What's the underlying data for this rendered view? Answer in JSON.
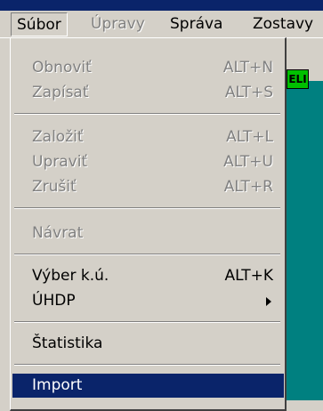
{
  "menubar": {
    "items": [
      {
        "label": "Súbor",
        "state": "active"
      },
      {
        "label": "Úpravy",
        "state": "disabled"
      },
      {
        "label": "Správa",
        "state": "normal"
      },
      {
        "label": "Zostavy",
        "state": "normal"
      }
    ]
  },
  "dropdown": {
    "items": [
      {
        "label": "Obnoviť",
        "shortcut": "ALT+N",
        "enabled": false
      },
      {
        "label": "Zapísať",
        "shortcut": "ALT+S",
        "enabled": false
      },
      {
        "label": "Založiť",
        "shortcut": "ALT+L",
        "enabled": false
      },
      {
        "label": "Upraviť",
        "shortcut": "ALT+U",
        "enabled": false
      },
      {
        "label": "Zrušiť",
        "shortcut": "ALT+R",
        "enabled": false
      },
      {
        "label": "Návrat",
        "shortcut": "",
        "enabled": false
      },
      {
        "label": "Výber k.ú.",
        "shortcut": "ALT+K",
        "enabled": true
      },
      {
        "label": "ÚHDP",
        "shortcut": "",
        "enabled": true,
        "submenu": true
      },
      {
        "label": "Štatistika",
        "shortcut": "",
        "enabled": true
      },
      {
        "label": "Import",
        "shortcut": "",
        "enabled": true,
        "highlighted": true
      }
    ]
  },
  "background_icon": {
    "text": "ELI"
  },
  "colors": {
    "face": "#d4d0c8",
    "highlight": "#0a246a",
    "desktop": "#008080",
    "disabled": "#808080"
  }
}
